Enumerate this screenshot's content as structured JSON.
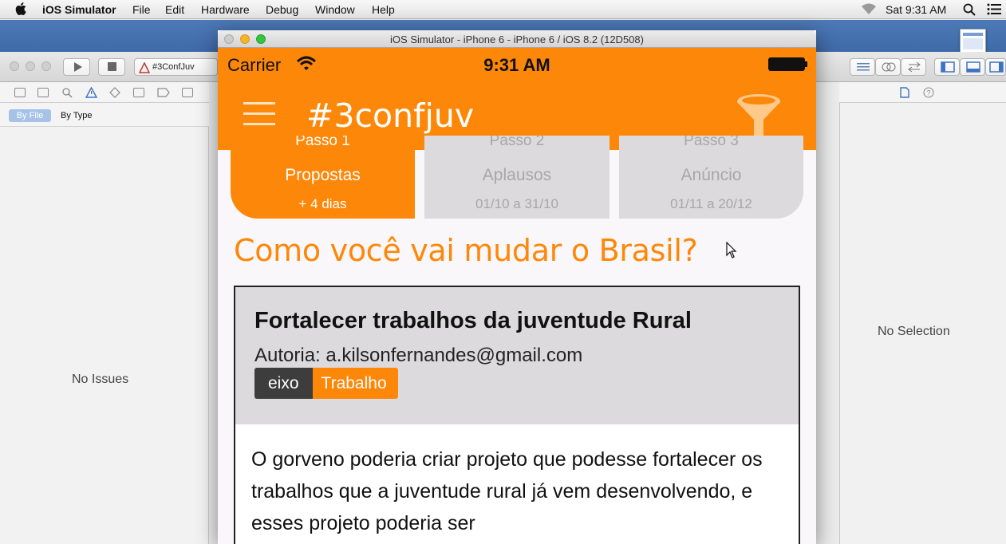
{
  "menubar": {
    "app": "iOS Simulator",
    "items": [
      "File",
      "Edit",
      "Hardware",
      "Debug",
      "Window",
      "Help"
    ],
    "clock": "Sat 9:31 AM"
  },
  "xcode": {
    "scheme": "#3ConfJuv",
    "filter_by_file": "By File",
    "filter_by_type": "By Type",
    "left_empty": "No Issues",
    "right_empty": "No Selection"
  },
  "simulator": {
    "window_title": "iOS Simulator - iPhone 6 - iPhone 6 / iOS 8.2 (12D508)"
  },
  "app": {
    "status": {
      "carrier": "Carrier",
      "time": "9:31 AM"
    },
    "title": "#3confjuv",
    "steps": [
      {
        "step": "Passo 1",
        "title": "Propostas",
        "date": "+ 4 dias"
      },
      {
        "step": "Passo 2",
        "title": "Aplausos",
        "date": "01/10 a 31/10"
      },
      {
        "step": "Passo 3",
        "title": "Anúncio",
        "date": "01/11 a 20/12"
      }
    ],
    "question": "Como você vai mudar o Brasil?",
    "card": {
      "title": "Fortalecer trabalhos da juventude Rural",
      "author": "Autoria: a.kilsonfernandes@gmail.com",
      "tag_label": "eixo",
      "tag_value": "Trabalho",
      "body": "O gorveno poderia criar projeto que podesse fortalecer os trabalhos que a juventude rural já vem desenvolvendo, e esses projeto poderia ser"
    }
  },
  "colors": {
    "accent": "#fd8709",
    "tab_inactive": "#dcdadc",
    "card_head": "#dcdadc"
  },
  "icons": [
    "apple-icon",
    "wifi-icon",
    "battery-icon",
    "menu-icon",
    "filter-funnel-icon",
    "search-icon",
    "list-icon",
    "cursor-icon"
  ]
}
